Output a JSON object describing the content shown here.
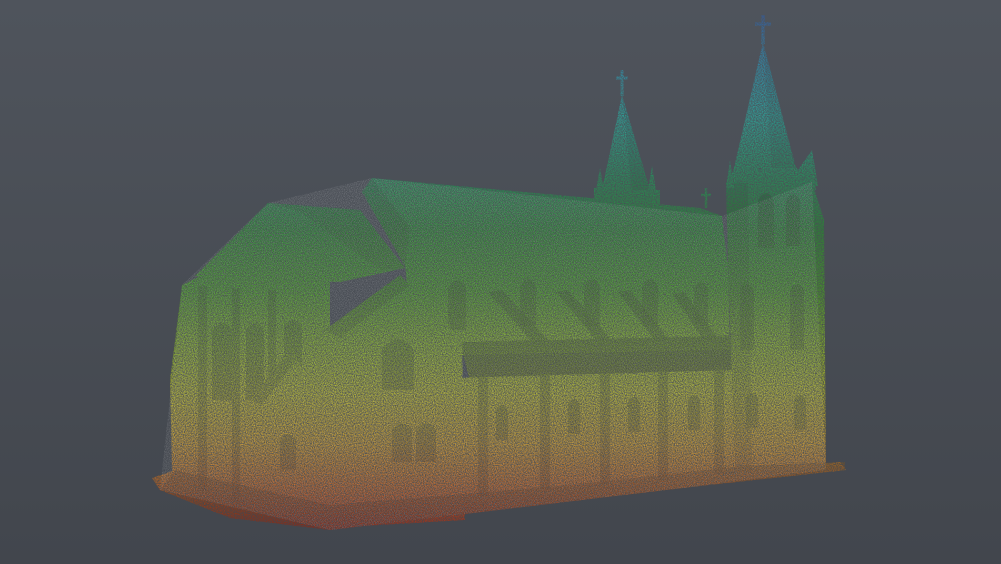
{
  "viewer": {
    "background_top": "#4f545c",
    "background_bottom": "#454950",
    "colormap": [
      "#c92a0a",
      "#e86d10",
      "#f2b21a",
      "#d8dc20",
      "#8fd21a",
      "#3bb215",
      "#1e9a2a",
      "#21b89a",
      "#2a9ec0",
      "#2a6fb8"
    ]
  },
  "scene": {
    "subject": "church-point-cloud",
    "color_by": "height"
  }
}
